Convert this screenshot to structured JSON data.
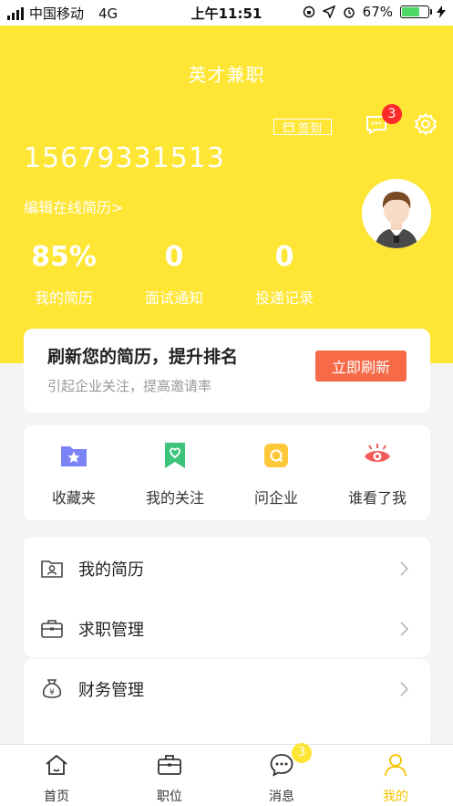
{
  "status_bar": {
    "carrier": "中国移动",
    "network": "4G",
    "time": "上午11:51",
    "battery_percent": "67%",
    "battery_level": 0.67
  },
  "header": {
    "app_title": "英才兼职",
    "checkin_label": "签到",
    "message_badge": "3",
    "phone": "15679331513",
    "edit_resume_link": "编辑在线简历>",
    "stats": [
      {
        "value": "85%",
        "label": "我的简历"
      },
      {
        "value": "0",
        "label": "面试通知"
      },
      {
        "value": "0",
        "label": "投递记录"
      }
    ]
  },
  "refresh": {
    "title": "刷新您的简历，提升排名",
    "subtitle": "引起企业关注，提高邀请率",
    "button": "立即刷新"
  },
  "quick_actions": [
    {
      "label": "收藏夹",
      "icon": "folder-star-icon"
    },
    {
      "label": "我的关注",
      "icon": "bookmark-heart-icon"
    },
    {
      "label": "问企业",
      "icon": "chat-question-icon"
    },
    {
      "label": "谁看了我",
      "icon": "eye-icon"
    }
  ],
  "menu": [
    {
      "label": "我的简历",
      "icon": "resume-icon"
    },
    {
      "label": "求职管理",
      "icon": "briefcase-icon"
    },
    {
      "label": "财务管理",
      "icon": "money-bag-icon"
    }
  ],
  "tabbar": {
    "tabs": [
      {
        "label": "首页",
        "icon": "home-icon"
      },
      {
        "label": "职位",
        "icon": "briefcase-icon"
      },
      {
        "label": "消息",
        "icon": "chat-icon"
      },
      {
        "label": "我的",
        "icon": "user-icon"
      }
    ],
    "message_badge": "3",
    "active_index": 3
  },
  "colors": {
    "header_bg": "#ffe534",
    "refresh_button": "#f66a47",
    "badge_red": "#ff2a2a",
    "active_tab": "#f2c400"
  }
}
